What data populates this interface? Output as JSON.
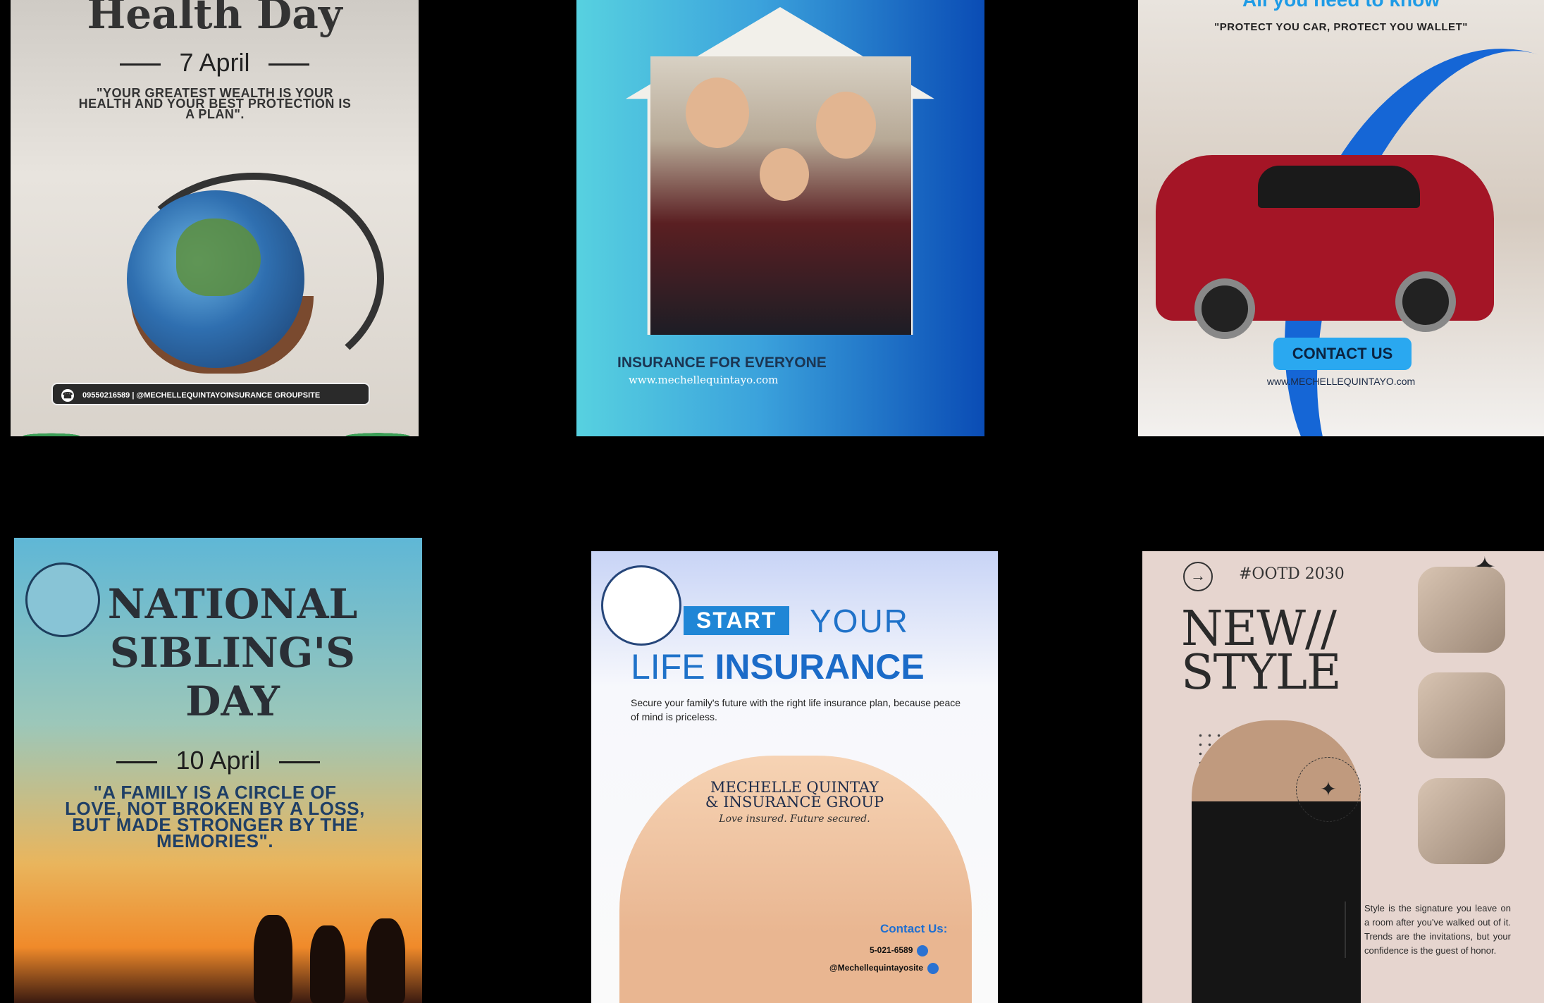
{
  "cards": {
    "health": {
      "title": "Health Day",
      "date": "7 April",
      "quote": "\"YOUR GREATEST WEALTH IS YOUR HEALTH AND YOUR BEST PROTECTION IS A PLAN\".",
      "contact": "09550216589 | @MECHELLEQUINTAYOINSURANCE GROUPSITE"
    },
    "family": {
      "heading": "INSURANCE FOR EVERYONE",
      "url": "www.mechellequintayo.com"
    },
    "car": {
      "heading": "All you need to know",
      "tagline": "\"PROTECT YOU CAR, PROTECT YOU WALLET\"",
      "cta": "CONTACT US",
      "url": "www.MECHELLEQUINTAYO.com"
    },
    "sibling": {
      "title": "NATIONAL SIBLING'S DAY",
      "date": "10 April",
      "quote": "\"A FAMILY IS A CIRCLE OF LOVE, NOT BROKEN BY A LOSS, BUT MADE STRONGER BY THE MEMORIES\"."
    },
    "life": {
      "start": "START",
      "your": "YOUR",
      "life_word": "LIFE",
      "insurance_word": "INSURANCE",
      "subtitle": "Secure your family's future with the right life insurance plan, because peace of mind is priceless.",
      "brand_line1": "MECHELLE QUINTAY",
      "brand_line2": "& INSURANCE GROUP",
      "brand_tagline": "Love insured. Future secured.",
      "contact_heading": "Contact Us:",
      "phone": "5-021-6589",
      "social": "@Mechellequintayosite"
    },
    "style": {
      "tag": "#OOTD 2030",
      "headline_line1": "NEW//",
      "headline_line2": "STYLE",
      "description": "Style is the signature you leave on a room after you've walked out of it. Trends are the invitations, but your confidence is the guest of honor."
    }
  },
  "icons": [
    "phone-icon",
    "arrow-right-icon",
    "sparkle-icon",
    "verified-icon",
    "globe-icon"
  ]
}
